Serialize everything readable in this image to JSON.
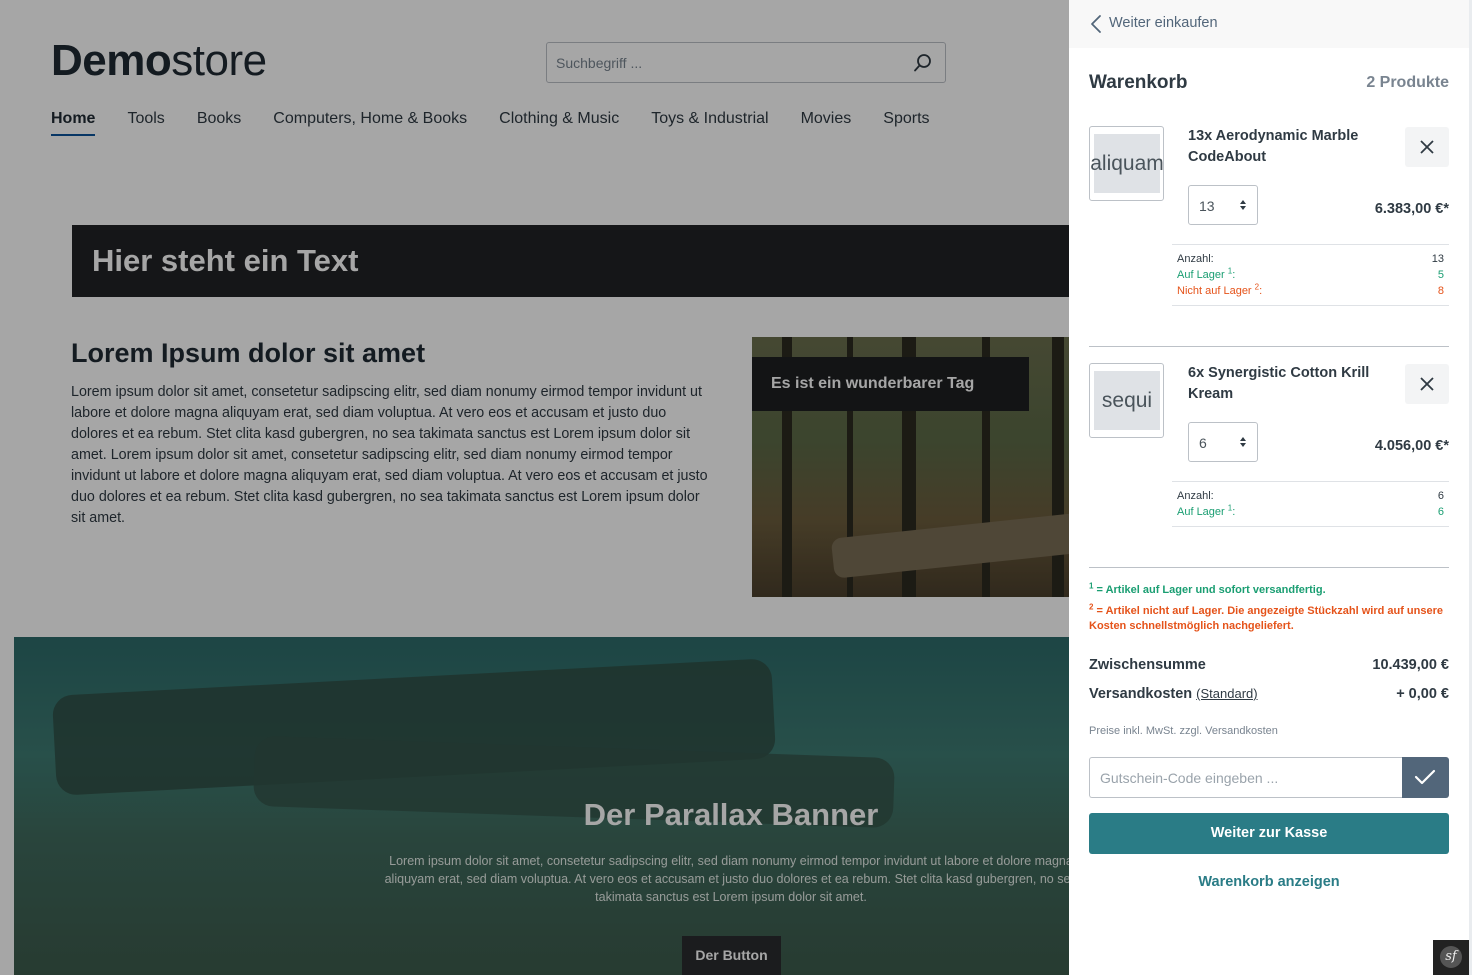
{
  "store": {
    "logo_bold": "Demo",
    "logo_light": "store",
    "search_placeholder": "Suchbegriff ...",
    "nav": [
      "Home",
      "Tools",
      "Books",
      "Computers, Home & Books",
      "Clothing & Music",
      "Toys & Industrial",
      "Movies",
      "Sports"
    ],
    "hero_text": "Hier steht ein Text",
    "lorem_title": "Lorem Ipsum dolor sit amet",
    "lorem_body": "Lorem ipsum dolor sit amet, consetetur sadipscing elitr, sed diam nonumy eirmod tempor invidunt ut labore et dolore magna aliquyam erat, sed diam voluptua. At vero eos et accusam et justo duo dolores et ea rebum. Stet clita kasd gubergren, no sea takimata sanctus est Lorem ipsum dolor sit amet. Lorem ipsum dolor sit amet, consetetur sadipscing elitr, sed diam nonumy eirmod tempor invidunt ut labore et dolore magna aliquyam erat, sed diam voluptua. At vero eos et accusam et justo duo dolores et ea rebum. Stet clita kasd gubergren, no sea takimata sanctus est Lorem ipsum dolor sit amet.",
    "image_caption": "Es ist ein wunderbarer Tag",
    "parallax_title": "Der Parallax Banner",
    "parallax_text": "Lorem ipsum dolor sit amet, consetetur sadipscing elitr, sed diam nonumy eirmod tempor invidunt ut labore et dolore magna aliquyam erat, sed diam voluptua. At vero eos et accusam et justo duo dolores et ea rebum. Stet clita kasd gubergren, no sea takimata sanctus est Lorem ipsum dolor sit amet.",
    "parallax_button": "Der Button"
  },
  "cart": {
    "back_label": "Weiter einkaufen",
    "title": "Warenkorb",
    "count": "2 Produkte",
    "items": [
      {
        "thumb": "aliquam",
        "name": "13x Aerodynamic Marble CodeAbout",
        "qty": "13",
        "price": "6.383,00 €*",
        "anzahl_label": "Anzahl:",
        "anzahl": "13",
        "in_stock_label": "Auf Lager",
        "in_stock_sup": "1",
        "in_stock": "5",
        "out_stock_label": "Nicht auf Lager",
        "out_stock_sup": "2",
        "out_stock": "8"
      },
      {
        "thumb": "sequi",
        "name": "6x Synergistic Cotton Krill Kream",
        "qty": "6",
        "price": "4.056,00 €*",
        "anzahl_label": "Anzahl:",
        "anzahl": "6",
        "in_stock_label": "Auf Lager",
        "in_stock_sup": "1",
        "in_stock": "6"
      }
    ],
    "legend_1_sup": "1",
    "legend_1": "= Artikel auf Lager und sofort versandfertig.",
    "legend_2_sup": "2",
    "legend_2": "= Artikel nicht auf Lager. Die angezeigte Stückzahl wird auf unsere Kosten schnellstmöglich nachgeliefert.",
    "subtotal_label": "Zwischensumme",
    "subtotal": "10.439,00 €",
    "shipping_label": "Versandkosten",
    "shipping_method": "(Standard)",
    "shipping": "+ 0,00 €",
    "tax_note": "Preise inkl. MwSt. zzgl. Versandkosten",
    "voucher_placeholder": "Gutschein-Code eingeben ...",
    "checkout_label": "Weiter zur Kasse",
    "show_cart_label": "Warenkorb anzeigen"
  },
  "colors": {
    "accent": "#2a7c86",
    "in_stock": "#1a9e72",
    "out_of_stock": "#e5531a"
  },
  "icons": [
    "search-icon",
    "chevron-left-icon",
    "close-icon",
    "select-arrows-icon",
    "checkmark-icon",
    "symfony-icon"
  ]
}
